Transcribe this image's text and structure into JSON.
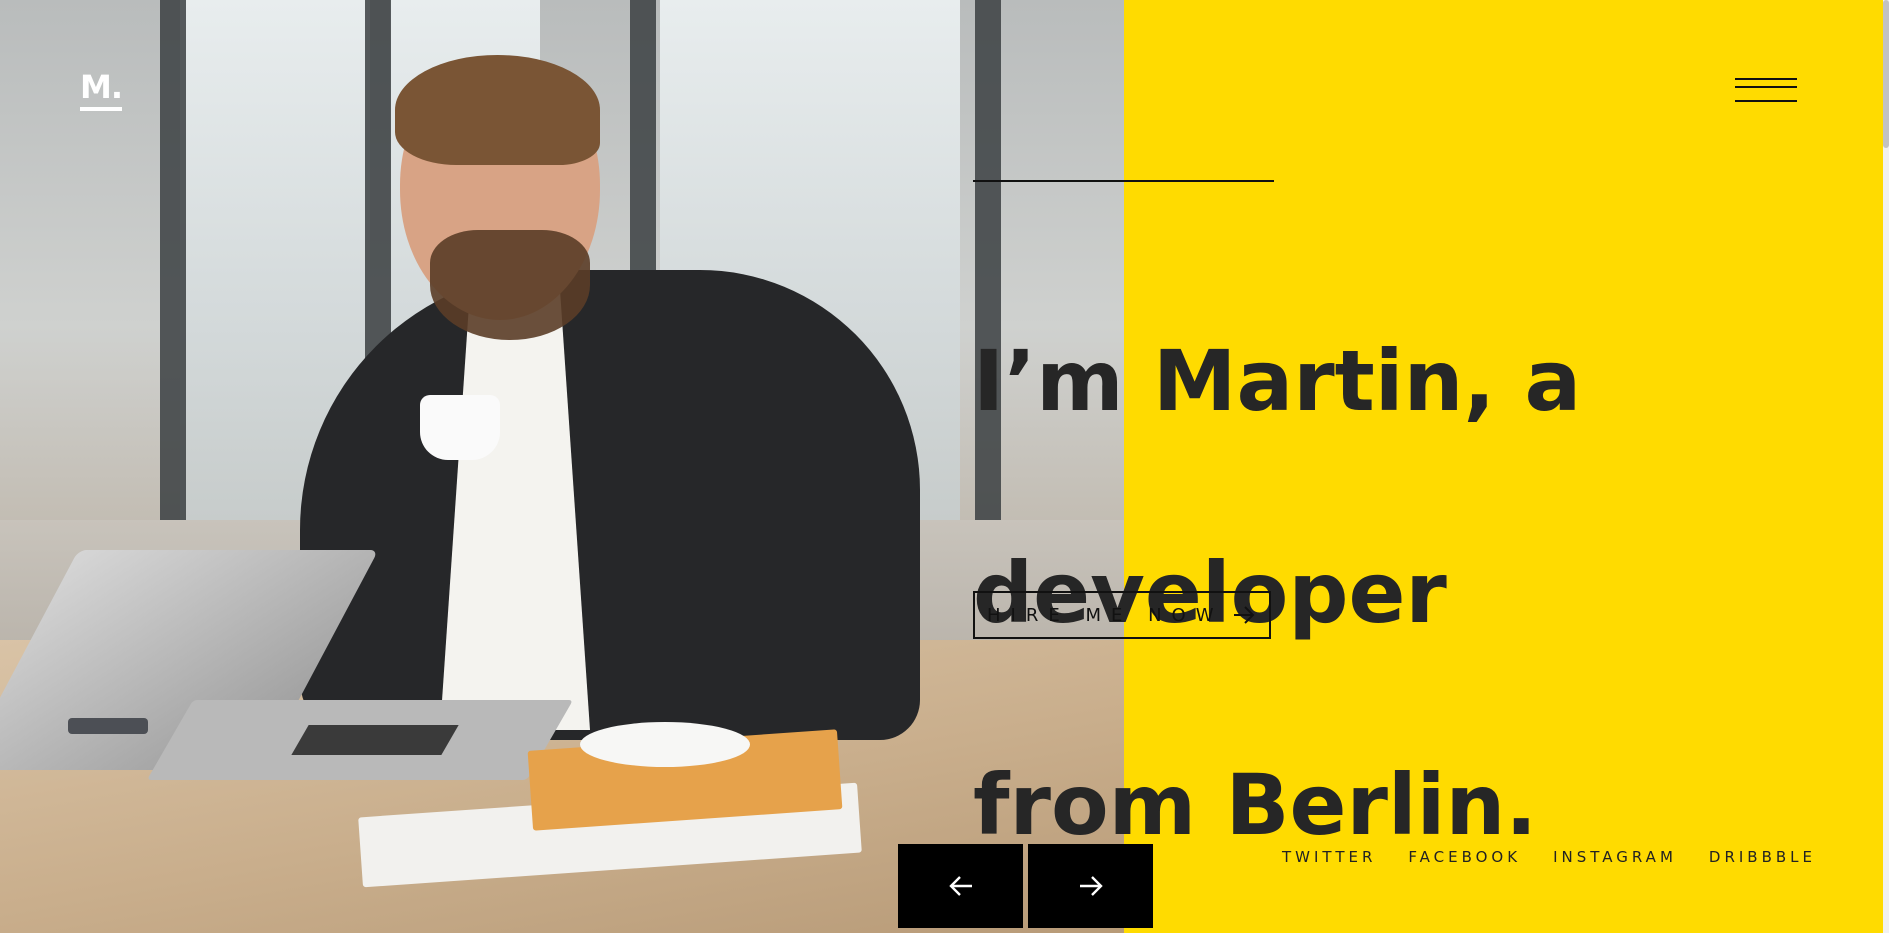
{
  "brand": {
    "logo_text": "M."
  },
  "hero": {
    "heading_lines": [
      "I’m Martin, a",
      "developer",
      "from Berlin."
    ],
    "cta_label": "HIRE ME NOW"
  },
  "socials": [
    "TWITTER",
    "FACEBOOK",
    "INSTAGRAM",
    "DRIBBBLE"
  ],
  "colors": {
    "accent_yellow": "#ffdb00",
    "text_dark": "#262626",
    "button_black": "#000000"
  },
  "icons": {
    "menu": "hamburger-icon",
    "cta": "arrow-right-icon",
    "prev": "arrow-left-icon",
    "next": "arrow-right-icon"
  }
}
